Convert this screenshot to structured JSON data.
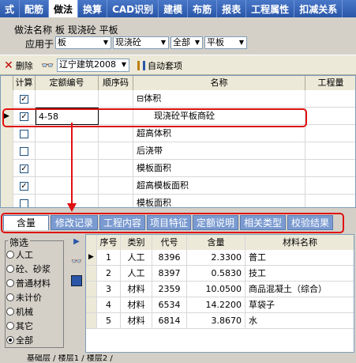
{
  "top_tabs": [
    "式",
    "配筋",
    "做法",
    "换算",
    "CAD识别",
    "建模",
    "布筋",
    "报表",
    "工程属性",
    "扣减关系"
  ],
  "name_panel": {
    "name_label": "做法名称",
    "name_value": "板 现浇砼 平板",
    "apply_label": "应用于",
    "combos": [
      "板",
      "现浇砼",
      "全部",
      "平板"
    ]
  },
  "toolbar": {
    "delete_label": "删除",
    "ref_combo": "辽宁建筑2008",
    "auto_label": "自动套项"
  },
  "grid": {
    "headers": [
      "计算",
      "定额编号",
      "顺序码",
      "名称",
      "工程量"
    ],
    "rows": [
      {
        "checked": true,
        "code": "",
        "name": "⊟体积",
        "indent": 0
      },
      {
        "checked": true,
        "code": "4-58",
        "name": "现浇砼平板商砼",
        "indent": 1,
        "selected": true
      },
      {
        "checked": false,
        "code": "",
        "name": "超高体积",
        "indent": 0
      },
      {
        "checked": false,
        "code": "",
        "name": "后浇带",
        "indent": 0
      },
      {
        "checked": true,
        "code": "",
        "name": "模板面积",
        "indent": 0
      },
      {
        "checked": true,
        "code": "",
        "name": "超高模板面积",
        "indent": 0
      },
      {
        "checked": false,
        "code": "",
        "name": "模板面积",
        "indent": 0
      }
    ]
  },
  "lower_tabs": [
    "含量",
    "修改记录",
    "工程内容",
    "项目特征",
    "定额说明",
    "相关类型",
    "校验结果"
  ],
  "filter": {
    "title": "筛选",
    "options": [
      "人工",
      "砼、砂浆",
      "普通材料",
      "未计价",
      "机械",
      "其它",
      "全部"
    ],
    "selected": 6
  },
  "materials": {
    "headers": [
      "序号",
      "类别",
      "代号",
      "含量",
      "材料名称"
    ],
    "rows": [
      [
        "1",
        "人工",
        "8396",
        "2.3300",
        "普工"
      ],
      [
        "2",
        "人工",
        "8397",
        "0.5830",
        "技工"
      ],
      [
        "3",
        "材料",
        "2359",
        "10.0500",
        "商品混凝土（综合）"
      ],
      [
        "4",
        "材料",
        "6534",
        "14.2200",
        "草袋子"
      ],
      [
        "5",
        "材料",
        "6814",
        "3.8670",
        "水"
      ]
    ]
  },
  "bottom": {
    "label": "基础层 / 楼层1 / 楼层2 /"
  },
  "colors": {
    "accent": "#2a56a8",
    "highlight": "#e01010"
  }
}
